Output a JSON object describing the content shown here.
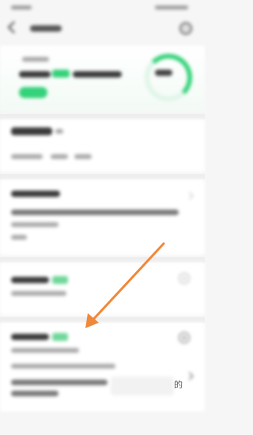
{
  "header": {
    "title": "",
    "banner_title": "",
    "banner_subtitle": "",
    "banner_button": "",
    "progress_text": ""
  },
  "sections": [
    {
      "title": "",
      "meta": [
        "",
        "",
        "",
        ""
      ]
    },
    {
      "title": "",
      "lines": [
        "",
        "",
        ""
      ]
    }
  ],
  "personal_section": {
    "title": "",
    "badge": "",
    "subtitle": ""
  },
  "work_section": {
    "title": "",
    "badge": "",
    "subtitle": "",
    "summary": "",
    "trailing_text": "的"
  },
  "colors": {
    "accent": "#34d27a",
    "arrow": "#f0883a"
  }
}
